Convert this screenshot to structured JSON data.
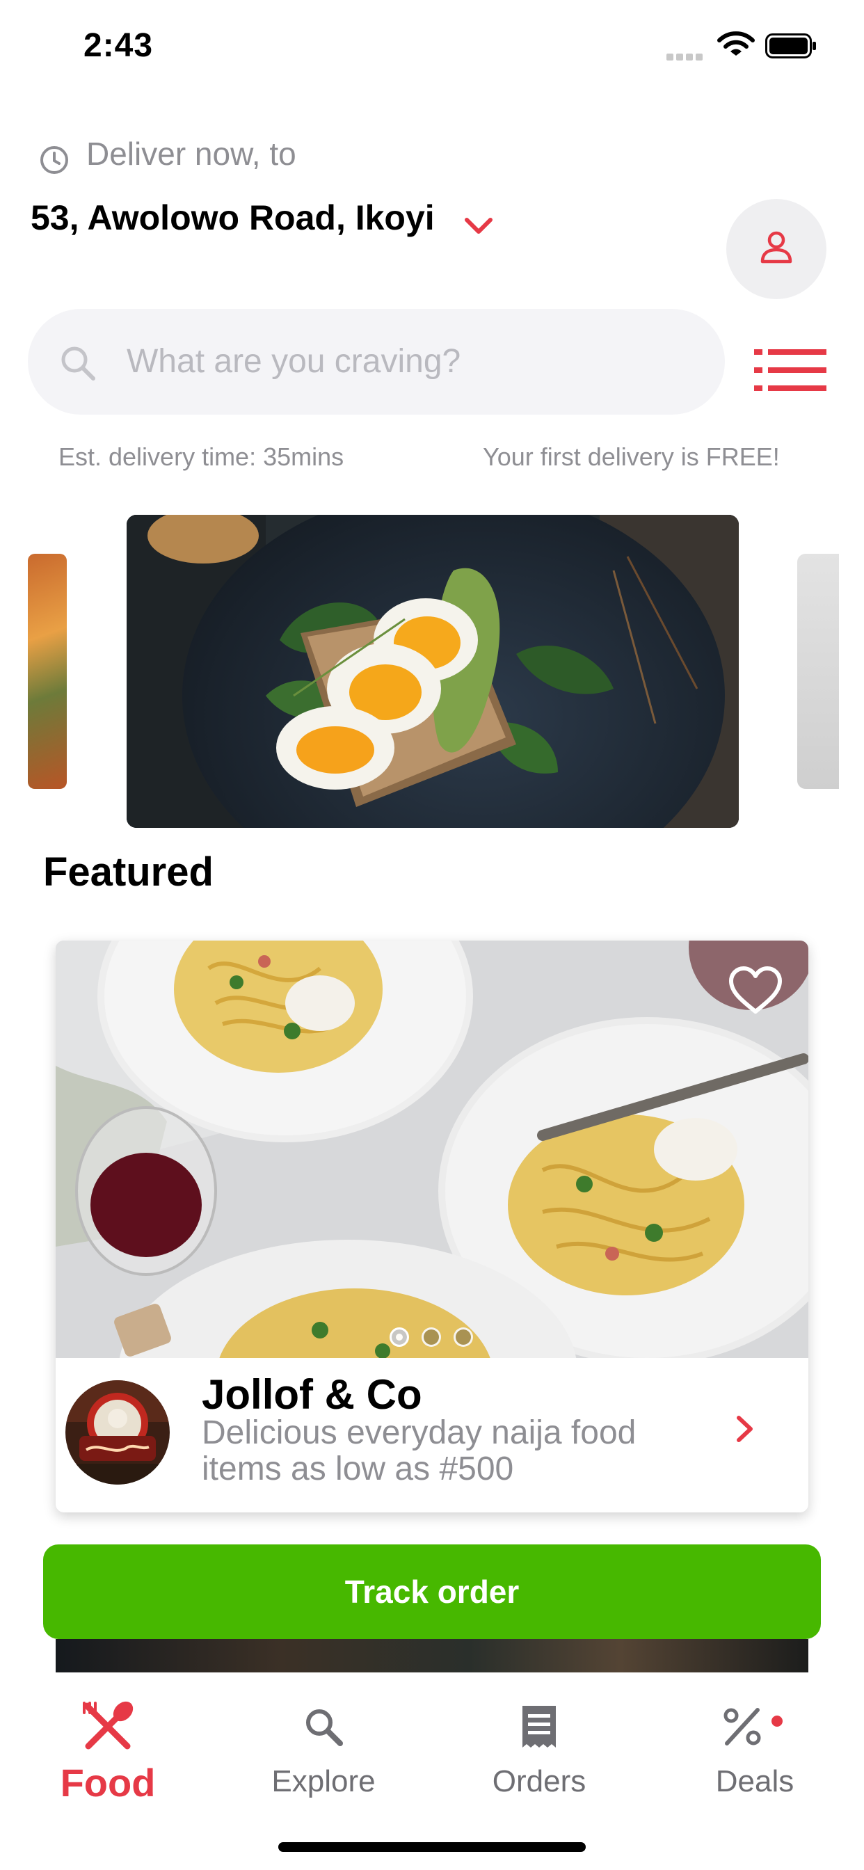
{
  "status_bar": {
    "time": "2:43"
  },
  "header": {
    "deliver_label": "Deliver now, to",
    "address": "53, Awolowo Road, Ikoyi"
  },
  "search": {
    "placeholder": "What are you craving?"
  },
  "info": {
    "delivery_time": "Est. delivery time: 35mins",
    "promo": "Your first delivery is FREE!"
  },
  "featured": {
    "title": "Featured",
    "restaurant_name": "Jollof & Co",
    "description": "Delicious everyday naija food items as low as #500",
    "carousel_dots": 3,
    "active_dot": 1
  },
  "track_order": {
    "label": "Track order"
  },
  "tabs": [
    {
      "label": "Food",
      "icon": "fork-spoon-icon",
      "active": true
    },
    {
      "label": "Explore",
      "icon": "search-icon",
      "active": false
    },
    {
      "label": "Orders",
      "icon": "receipt-icon",
      "active": false
    },
    {
      "label": "Deals",
      "icon": "percent-icon",
      "active": false
    }
  ],
  "colors": {
    "accent": "#e63946",
    "primary_button": "#47b800",
    "muted_text": "#8e8e93",
    "field_background": "#f4f4f7"
  }
}
